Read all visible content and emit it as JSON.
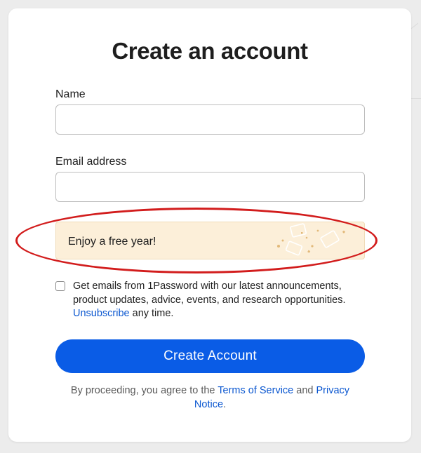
{
  "form": {
    "title": "Create an account",
    "name_label": "Name",
    "name_value": "",
    "email_label": "Email address",
    "email_value": "",
    "promo_text": "Enjoy a free year!",
    "consent_text": "Get emails from 1Password with our latest announcements, product updates, advice, events, and research opportunities.",
    "unsubscribe_link": "Unsubscribe",
    "consent_suffix": "any time.",
    "consent_checked": false,
    "submit_label": "Create Account",
    "legal_prefix": "By proceeding, you agree to the",
    "terms_link": "Terms of Service",
    "legal_and": "and",
    "privacy_link": "Privacy Notice",
    "legal_period": "."
  },
  "colors": {
    "accent": "#0a5ce6",
    "link": "#0b57d0",
    "promo_bg": "#fcefd9",
    "highlight": "#d21c1c"
  }
}
